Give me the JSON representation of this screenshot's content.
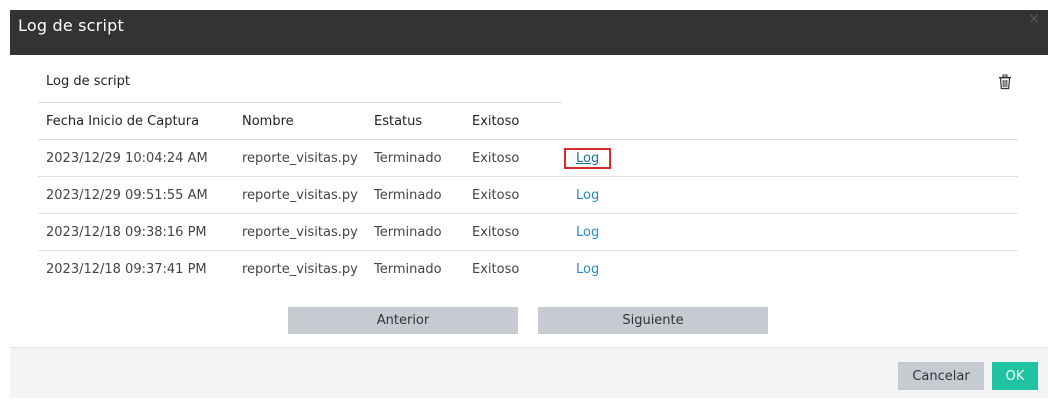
{
  "dialog": {
    "title": "Log de script",
    "close_glyph": "×"
  },
  "section": {
    "title": "Log de script",
    "delete_icon": "trash-icon"
  },
  "table": {
    "headers": [
      "Fecha Inicio de Captura",
      "Nombre",
      "Estatus",
      "Exitoso",
      ""
    ],
    "rows": [
      {
        "fecha": "2023/12/29 10:04:24 AM",
        "nombre": "reporte_visitas.py",
        "estatus": "Terminado",
        "exitoso": "Exitoso",
        "link": "Log",
        "active": true
      },
      {
        "fecha": "2023/12/29 09:51:55 AM",
        "nombre": "reporte_visitas.py",
        "estatus": "Terminado",
        "exitoso": "Exitoso",
        "link": "Log",
        "active": false
      },
      {
        "fecha": "2023/12/18 09:38:16 PM",
        "nombre": "reporte_visitas.py",
        "estatus": "Terminado",
        "exitoso": "Exitoso",
        "link": "Log",
        "active": false
      },
      {
        "fecha": "2023/12/18 09:37:41 PM",
        "nombre": "reporte_visitas.py",
        "estatus": "Terminado",
        "exitoso": "Exitoso",
        "link": "Log",
        "active": false
      }
    ]
  },
  "pager": {
    "prev_label": "Anterior",
    "next_label": "Siguiente"
  },
  "footer": {
    "cancel_label": "Cancelar",
    "ok_label": "OK"
  },
  "colors": {
    "titlebar": "#333333",
    "link": "#2a8bbf",
    "highlight_border": "#d62b2b",
    "ok_button": "#1fc2a3",
    "secondary_button": "#c5cbd1"
  }
}
